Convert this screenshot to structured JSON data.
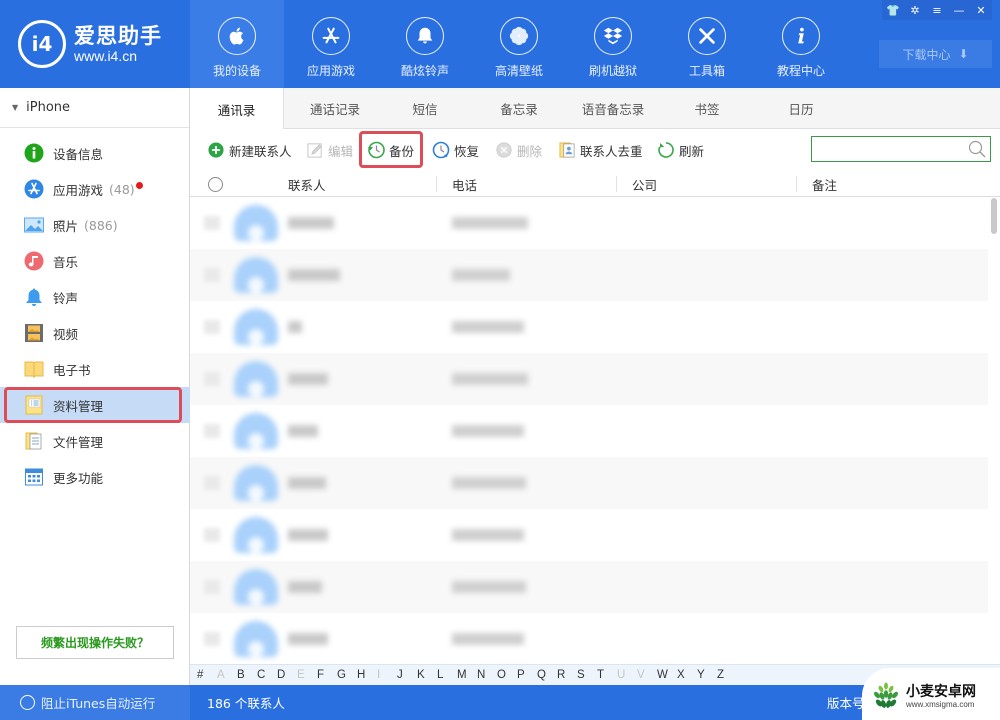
{
  "app": {
    "name_cn": "爱思助手",
    "url": "www.i4.cn",
    "logo_mark": "i4"
  },
  "nav": [
    {
      "label": "我的设备",
      "icon": "apple-icon",
      "active": true
    },
    {
      "label": "应用游戏",
      "icon": "app-store-icon",
      "active": false
    },
    {
      "label": "酷炫铃声",
      "icon": "bell-icon",
      "active": false
    },
    {
      "label": "高清壁纸",
      "icon": "flower-icon",
      "active": false
    },
    {
      "label": "刷机越狱",
      "icon": "dropbox-box-icon",
      "active": false
    },
    {
      "label": "工具箱",
      "icon": "tools-icon",
      "active": false
    },
    {
      "label": "教程中心",
      "icon": "info-icon",
      "active": false
    }
  ],
  "window_controls": {
    "skin": "👕",
    "settings": "✲",
    "menu": "≡",
    "minimize": "—",
    "close": "✕"
  },
  "download_center": {
    "label": "下载中心",
    "icon": "⬇"
  },
  "sidebar": {
    "device_name": "iPhone",
    "items": [
      {
        "label": "设备信息",
        "count": "",
        "badge": false,
        "icon": "info-icon"
      },
      {
        "label": "应用游戏",
        "count": "(48)",
        "badge": true,
        "icon": "app-store-icon"
      },
      {
        "label": "照片",
        "count": "(886)",
        "badge": false,
        "icon": "photo-icon"
      },
      {
        "label": "音乐",
        "count": "",
        "badge": false,
        "icon": "music-icon"
      },
      {
        "label": "铃声",
        "count": "",
        "badge": false,
        "icon": "bell-icon"
      },
      {
        "label": "视频",
        "count": "",
        "badge": false,
        "icon": "video-icon"
      },
      {
        "label": "电子书",
        "count": "",
        "badge": false,
        "icon": "book-icon"
      },
      {
        "label": "资料管理",
        "count": "",
        "badge": false,
        "icon": "data-management-icon",
        "selected": true
      },
      {
        "label": "文件管理",
        "count": "",
        "badge": false,
        "icon": "file-management-icon"
      },
      {
        "label": "更多功能",
        "count": "",
        "badge": false,
        "icon": "more-functions-icon"
      }
    ],
    "help_button": "频繁出现操作失败？"
  },
  "tabs": [
    {
      "label": "通讯录",
      "active": true
    },
    {
      "label": "通话记录",
      "active": false
    },
    {
      "label": "短信",
      "active": false
    },
    {
      "label": "备忘录",
      "active": false
    },
    {
      "label": "语音备忘录",
      "active": false
    },
    {
      "label": "书签",
      "active": false
    },
    {
      "label": "日历",
      "active": false
    }
  ],
  "toolbar": {
    "new_contact": "新建联系人",
    "edit": "编辑",
    "backup": "备份",
    "restore": "恢复",
    "delete": "删除",
    "dedupe": "联系人去重",
    "refresh": "刷新",
    "search_value": "",
    "search_placeholder": ""
  },
  "table": {
    "columns": [
      "联系人",
      "电话",
      "公司",
      "备注"
    ],
    "rows_blurred": true,
    "visible_row_count": 9
  },
  "alphabet": {
    "letters": [
      "#",
      "A",
      "B",
      "C",
      "D",
      "E",
      "F",
      "G",
      "H",
      "I",
      "J",
      "K",
      "L",
      "M",
      "N",
      "O",
      "P",
      "Q",
      "R",
      "S",
      "T",
      "U",
      "V",
      "W",
      "X",
      "Y",
      "Z"
    ],
    "disabled": [
      "A",
      "E",
      "I",
      "U",
      "V"
    ]
  },
  "statusbar": {
    "itunes_block": "阻止iTunes自动运行",
    "contact_count": "186 个联系人",
    "version_label": "版本号"
  },
  "watermark": {
    "title": "小麦安卓网",
    "url": "www.xmsigma.com"
  },
  "colors": {
    "brand_blue": "#2a6fe0",
    "highlight_red": "#dc4d58",
    "selected_bg": "#c6dbf6",
    "help_green": "#2a9a1f"
  }
}
